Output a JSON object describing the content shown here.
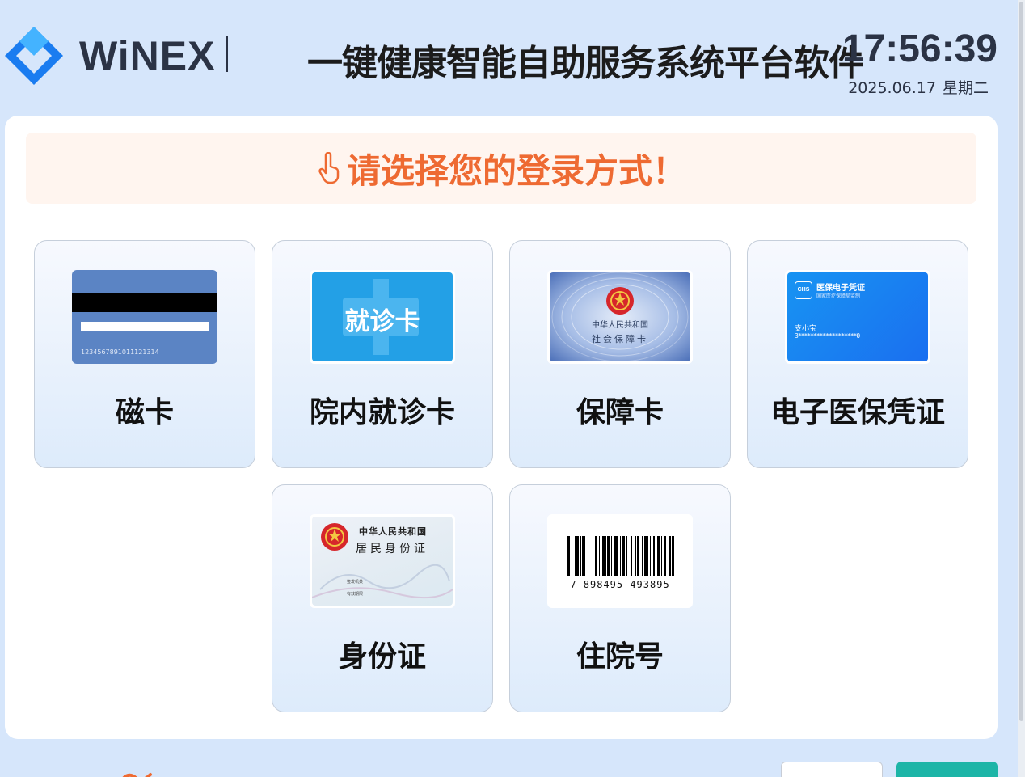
{
  "header": {
    "brand": "WiNEX",
    "app_title": "一键健康智能自助服务系统平台软件",
    "time": "17:56:39",
    "date": "2025.06.17",
    "weekday": "星期二"
  },
  "banner": {
    "text": "请选择您的登录方式！"
  },
  "login_options": [
    {
      "label": "磁卡",
      "card_number": "1234567891011121314"
    },
    {
      "label": "院内就诊卡",
      "card_text": "就诊卡"
    },
    {
      "label": "保障卡",
      "card_line1": "中华人民共和国",
      "card_line2": "社会保障卡"
    },
    {
      "label": "电子医保凭证",
      "card_logo": "CHS",
      "card_title": "医保电子凭证",
      "card_sub": "国家医疗保障局监制",
      "card_name": "支小宝",
      "card_id": "3*******************0"
    },
    {
      "label": "身份证",
      "card_line1": "中华人民共和国",
      "card_line2": "居民身份证",
      "card_field1": "签发机关",
      "card_field2": "有效期限"
    },
    {
      "label": "住院号",
      "barcode": "7 898495 493895"
    }
  ],
  "colors": {
    "accent": "#ee6a32",
    "brand_blue": "#1a7cf0",
    "primary_button": "#1db5a7"
  }
}
